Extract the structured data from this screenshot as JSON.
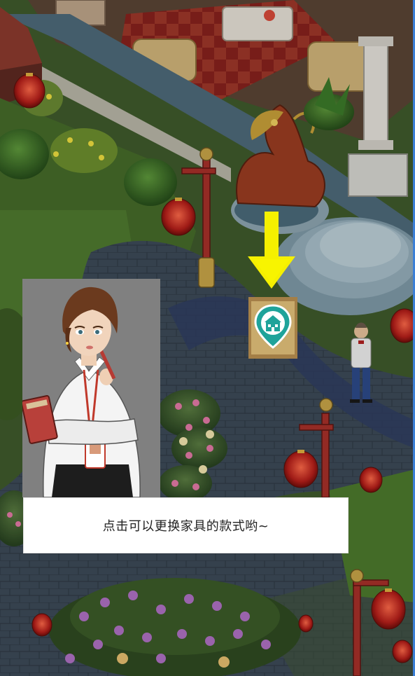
{
  "tutorial": {
    "dialog_text": "点击可以更换家具的款式哟~",
    "arrow_color": "#f5f000"
  },
  "swap_button": {
    "icon": "house-pin-icon",
    "accent": "#1fa39a"
  },
  "character": {
    "role": "designer-assistant",
    "portrait_bg": "#808080"
  }
}
